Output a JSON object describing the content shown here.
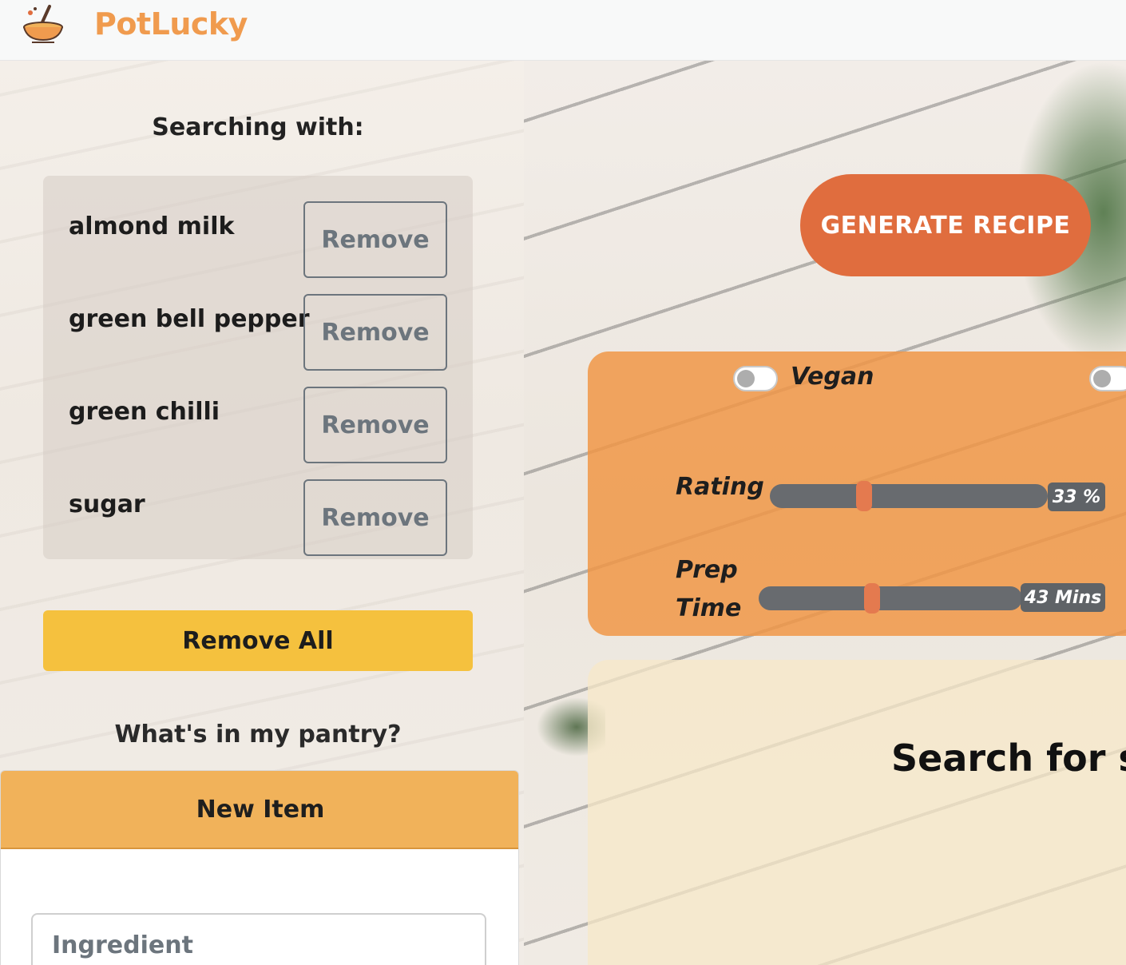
{
  "header": {
    "brand": "PotLucky",
    "logo_icon": "mixing-bowl-icon"
  },
  "searching": {
    "title": "Searching with:",
    "ingredients": [
      {
        "name": "almond milk",
        "remove_label": "Remove"
      },
      {
        "name": "green bell pepper",
        "remove_label": "Remove"
      },
      {
        "name": "green chilli",
        "remove_label": "Remove"
      },
      {
        "name": "sugar",
        "remove_label": "Remove"
      }
    ],
    "remove_all_label": "Remove All"
  },
  "pantry": {
    "title": "What's in my pantry?",
    "new_item_header": "New Item",
    "ingredient_placeholder": "Ingredient"
  },
  "actions": {
    "generate_label": "GENERATE RECIPE"
  },
  "filters": {
    "vegan_label": "Vegan",
    "vegan_on": false,
    "second_toggle_on": false,
    "rating": {
      "label": "Rating",
      "value": 33,
      "display": "33 %"
    },
    "prep_time": {
      "label_line1": "Prep",
      "label_line2": "Time",
      "value": 43,
      "max": 120,
      "display": "43 Mins"
    }
  },
  "results": {
    "title": "Search for so"
  },
  "colors": {
    "brand": "#f09b4e",
    "generate": "#e06d3e",
    "remove_all": "#f5c13e",
    "panel": "#f09646",
    "slider_thumb": "#e47a4f"
  }
}
